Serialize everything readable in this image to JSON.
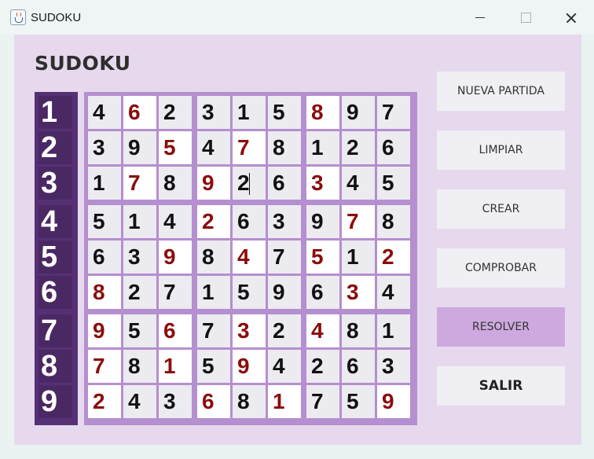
{
  "window": {
    "title": "SUDOKU"
  },
  "heading": "SUDOKU",
  "row_numbers": [
    "1",
    "2",
    "3",
    "4",
    "5",
    "6",
    "7",
    "8",
    "9"
  ],
  "colors": {
    "user_digit": "#8b0c0c",
    "given_digit": "#111111",
    "accent": "#563075"
  },
  "board": [
    [
      {
        "v": "4",
        "u": 0
      },
      {
        "v": "6",
        "u": 1
      },
      {
        "v": "2",
        "u": 0
      },
      {
        "v": "3",
        "u": 0
      },
      {
        "v": "1",
        "u": 0
      },
      {
        "v": "5",
        "u": 0
      },
      {
        "v": "8",
        "u": 1
      },
      {
        "v": "9",
        "u": 0
      },
      {
        "v": "7",
        "u": 0
      }
    ],
    [
      {
        "v": "3",
        "u": 0
      },
      {
        "v": "9",
        "u": 0
      },
      {
        "v": "5",
        "u": 1
      },
      {
        "v": "4",
        "u": 0
      },
      {
        "v": "7",
        "u": 1
      },
      {
        "v": "8",
        "u": 0
      },
      {
        "v": "1",
        "u": 0
      },
      {
        "v": "2",
        "u": 0
      },
      {
        "v": "6",
        "u": 0
      }
    ],
    [
      {
        "v": "1",
        "u": 0
      },
      {
        "v": "7",
        "u": 1
      },
      {
        "v": "8",
        "u": 0
      },
      {
        "v": "9",
        "u": 1
      },
      {
        "v": "2",
        "u": 0,
        "focus": 1
      },
      {
        "v": "6",
        "u": 0
      },
      {
        "v": "3",
        "u": 1
      },
      {
        "v": "4",
        "u": 0
      },
      {
        "v": "5",
        "u": 0
      }
    ],
    [
      {
        "v": "5",
        "u": 0
      },
      {
        "v": "1",
        "u": 0
      },
      {
        "v": "4",
        "u": 0
      },
      {
        "v": "2",
        "u": 1
      },
      {
        "v": "6",
        "u": 0
      },
      {
        "v": "3",
        "u": 0
      },
      {
        "v": "9",
        "u": 0
      },
      {
        "v": "7",
        "u": 1
      },
      {
        "v": "8",
        "u": 0
      }
    ],
    [
      {
        "v": "6",
        "u": 0
      },
      {
        "v": "3",
        "u": 0
      },
      {
        "v": "9",
        "u": 1
      },
      {
        "v": "8",
        "u": 0
      },
      {
        "v": "4",
        "u": 1
      },
      {
        "v": "7",
        "u": 0
      },
      {
        "v": "5",
        "u": 1
      },
      {
        "v": "1",
        "u": 0
      },
      {
        "v": "2",
        "u": 1
      }
    ],
    [
      {
        "v": "8",
        "u": 1
      },
      {
        "v": "2",
        "u": 0
      },
      {
        "v": "7",
        "u": 0
      },
      {
        "v": "1",
        "u": 0
      },
      {
        "v": "5",
        "u": 0
      },
      {
        "v": "9",
        "u": 0
      },
      {
        "v": "6",
        "u": 0
      },
      {
        "v": "3",
        "u": 1
      },
      {
        "v": "4",
        "u": 0
      }
    ],
    [
      {
        "v": "9",
        "u": 1
      },
      {
        "v": "5",
        "u": 0
      },
      {
        "v": "6",
        "u": 1
      },
      {
        "v": "7",
        "u": 0
      },
      {
        "v": "3",
        "u": 1
      },
      {
        "v": "2",
        "u": 0
      },
      {
        "v": "4",
        "u": 1
      },
      {
        "v": "8",
        "u": 0
      },
      {
        "v": "1",
        "u": 0
      }
    ],
    [
      {
        "v": "7",
        "u": 1
      },
      {
        "v": "8",
        "u": 0
      },
      {
        "v": "1",
        "u": 1
      },
      {
        "v": "5",
        "u": 0
      },
      {
        "v": "9",
        "u": 1
      },
      {
        "v": "4",
        "u": 0
      },
      {
        "v": "2",
        "u": 0
      },
      {
        "v": "6",
        "u": 0
      },
      {
        "v": "3",
        "u": 0
      }
    ],
    [
      {
        "v": "2",
        "u": 1
      },
      {
        "v": "4",
        "u": 0
      },
      {
        "v": "3",
        "u": 0
      },
      {
        "v": "6",
        "u": 1
      },
      {
        "v": "8",
        "u": 0
      },
      {
        "v": "1",
        "u": 1
      },
      {
        "v": "7",
        "u": 0
      },
      {
        "v": "5",
        "u": 0
      },
      {
        "v": "9",
        "u": 1
      }
    ]
  ],
  "buttons": {
    "nueva": "NUEVA  PARTIDA",
    "limpiar": "LIMPIAR",
    "crear": "CREAR",
    "comprobar": "COMPROBAR",
    "resolver": "RESOLVER",
    "salir": "SALIR"
  }
}
